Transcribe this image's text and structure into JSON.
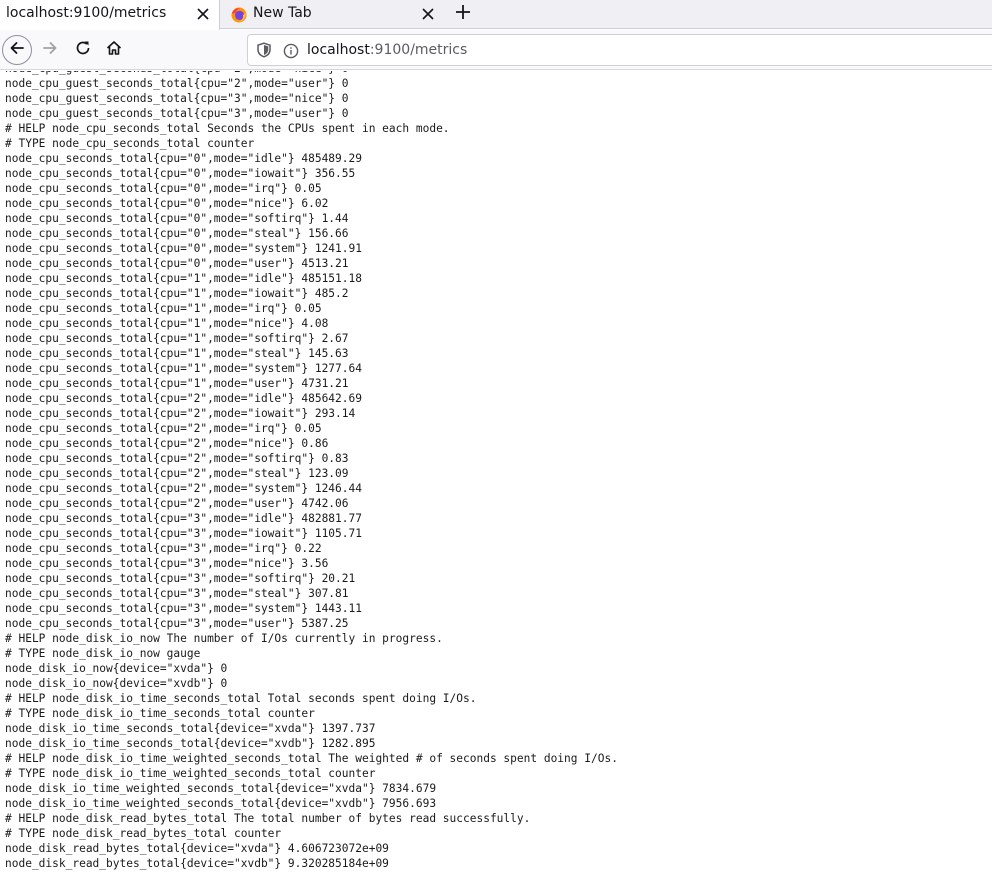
{
  "tabs": [
    {
      "title": "localhost:9100/metrics",
      "active": true
    },
    {
      "title": "New Tab",
      "active": false
    }
  ],
  "url": {
    "host": "localhost",
    "path": ":9100/metrics"
  },
  "icons": {
    "back": "arrow-left-icon",
    "forward": "arrow-right-icon",
    "reload": "reload-icon",
    "home": "home-icon",
    "shield": "shield-icon",
    "info": "info-icon",
    "close": "close-icon",
    "new_tab": "plus-icon",
    "favicon": "firefox-icon"
  },
  "colors": {
    "tab_strip": "#f0f0f4",
    "nav_bar": "#f9f9fb",
    "text": "#1a1a1a"
  },
  "lines": [
    "node_cpu_guest_seconds_total{cpu=\"2\",mode=\"nice\"} 0",
    "node_cpu_guest_seconds_total{cpu=\"2\",mode=\"user\"} 0",
    "node_cpu_guest_seconds_total{cpu=\"3\",mode=\"nice\"} 0",
    "node_cpu_guest_seconds_total{cpu=\"3\",mode=\"user\"} 0",
    "# HELP node_cpu_seconds_total Seconds the CPUs spent in each mode.",
    "# TYPE node_cpu_seconds_total counter",
    "node_cpu_seconds_total{cpu=\"0\",mode=\"idle\"} 485489.29",
    "node_cpu_seconds_total{cpu=\"0\",mode=\"iowait\"} 356.55",
    "node_cpu_seconds_total{cpu=\"0\",mode=\"irq\"} 0.05",
    "node_cpu_seconds_total{cpu=\"0\",mode=\"nice\"} 6.02",
    "node_cpu_seconds_total{cpu=\"0\",mode=\"softirq\"} 1.44",
    "node_cpu_seconds_total{cpu=\"0\",mode=\"steal\"} 156.66",
    "node_cpu_seconds_total{cpu=\"0\",mode=\"system\"} 1241.91",
    "node_cpu_seconds_total{cpu=\"0\",mode=\"user\"} 4513.21",
    "node_cpu_seconds_total{cpu=\"1\",mode=\"idle\"} 485151.18",
    "node_cpu_seconds_total{cpu=\"1\",mode=\"iowait\"} 485.2",
    "node_cpu_seconds_total{cpu=\"1\",mode=\"irq\"} 0.05",
    "node_cpu_seconds_total{cpu=\"1\",mode=\"nice\"} 4.08",
    "node_cpu_seconds_total{cpu=\"1\",mode=\"softirq\"} 2.67",
    "node_cpu_seconds_total{cpu=\"1\",mode=\"steal\"} 145.63",
    "node_cpu_seconds_total{cpu=\"1\",mode=\"system\"} 1277.64",
    "node_cpu_seconds_total{cpu=\"1\",mode=\"user\"} 4731.21",
    "node_cpu_seconds_total{cpu=\"2\",mode=\"idle\"} 485642.69",
    "node_cpu_seconds_total{cpu=\"2\",mode=\"iowait\"} 293.14",
    "node_cpu_seconds_total{cpu=\"2\",mode=\"irq\"} 0.05",
    "node_cpu_seconds_total{cpu=\"2\",mode=\"nice\"} 0.86",
    "node_cpu_seconds_total{cpu=\"2\",mode=\"softirq\"} 0.83",
    "node_cpu_seconds_total{cpu=\"2\",mode=\"steal\"} 123.09",
    "node_cpu_seconds_total{cpu=\"2\",mode=\"system\"} 1246.44",
    "node_cpu_seconds_total{cpu=\"2\",mode=\"user\"} 4742.06",
    "node_cpu_seconds_total{cpu=\"3\",mode=\"idle\"} 482881.77",
    "node_cpu_seconds_total{cpu=\"3\",mode=\"iowait\"} 1105.71",
    "node_cpu_seconds_total{cpu=\"3\",mode=\"irq\"} 0.22",
    "node_cpu_seconds_total{cpu=\"3\",mode=\"nice\"} 3.56",
    "node_cpu_seconds_total{cpu=\"3\",mode=\"softirq\"} 20.21",
    "node_cpu_seconds_total{cpu=\"3\",mode=\"steal\"} 307.81",
    "node_cpu_seconds_total{cpu=\"3\",mode=\"system\"} 1443.11",
    "node_cpu_seconds_total{cpu=\"3\",mode=\"user\"} 5387.25",
    "# HELP node_disk_io_now The number of I/Os currently in progress.",
    "# TYPE node_disk_io_now gauge",
    "node_disk_io_now{device=\"xvda\"} 0",
    "node_disk_io_now{device=\"xvdb\"} 0",
    "# HELP node_disk_io_time_seconds_total Total seconds spent doing I/Os.",
    "# TYPE node_disk_io_time_seconds_total counter",
    "node_disk_io_time_seconds_total{device=\"xvda\"} 1397.737",
    "node_disk_io_time_seconds_total{device=\"xvdb\"} 1282.895",
    "# HELP node_disk_io_time_weighted_seconds_total The weighted # of seconds spent doing I/Os.",
    "# TYPE node_disk_io_time_weighted_seconds_total counter",
    "node_disk_io_time_weighted_seconds_total{device=\"xvda\"} 7834.679",
    "node_disk_io_time_weighted_seconds_total{device=\"xvdb\"} 7956.693",
    "# HELP node_disk_read_bytes_total The total number of bytes read successfully.",
    "# TYPE node_disk_read_bytes_total counter",
    "node_disk_read_bytes_total{device=\"xvda\"} 4.606723072e+09",
    "node_disk_read_bytes_total{device=\"xvdb\"} 9.320285184e+09"
  ]
}
